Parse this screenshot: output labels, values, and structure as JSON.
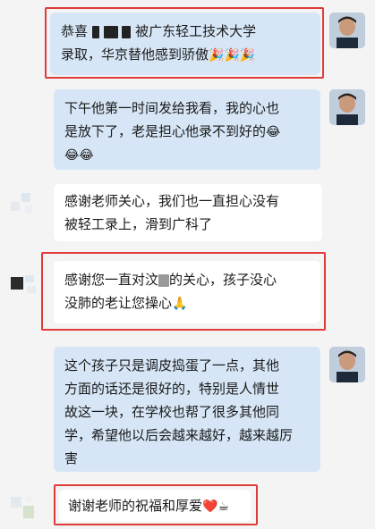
{
  "messages": [
    {
      "id": "m1",
      "sender": "me",
      "line1": "恭喜",
      "line1b": "被广东轻工技术大学",
      "line2": "录取，华京替他感到骄傲",
      "emoji": "🎉🎉🎉"
    },
    {
      "id": "m2",
      "sender": "me",
      "line1": "下午他第一时间发给我看，我的心也",
      "line2": "是放下了，老是担心他录不到好的",
      "emoji_end": "😂",
      "emoji_line3": "😂😂"
    },
    {
      "id": "m3",
      "sender": "them",
      "line1": "感谢老师关心，我们也一直担心没有",
      "line2": "被轻工录上，滑到广科了"
    },
    {
      "id": "m4",
      "sender": "them",
      "line1a": "感谢您一直对汶",
      "line1b": "的关心，孩子没心",
      "line2": "没肺的老让您操心",
      "emoji": "🙏"
    },
    {
      "id": "m5",
      "sender": "me",
      "line1": "这个孩子只是调皮捣蛋了一点，其他",
      "line2": "方面的话还是很好的，特别是人情世",
      "line3": "故这一块，在学校也帮了很多其他同",
      "line4": "学，希望他以后会越来越好，越来越厉",
      "line5": "害"
    },
    {
      "id": "m6",
      "sender": "them",
      "text": "谢谢老师的祝福和厚爱",
      "emoji": "❤️☕"
    }
  ],
  "colors": {
    "me_bubble": "#d6e6f6",
    "them_bubble": "#ffffff",
    "highlight": "#e03b3b",
    "background": "#f4f4f4"
  }
}
